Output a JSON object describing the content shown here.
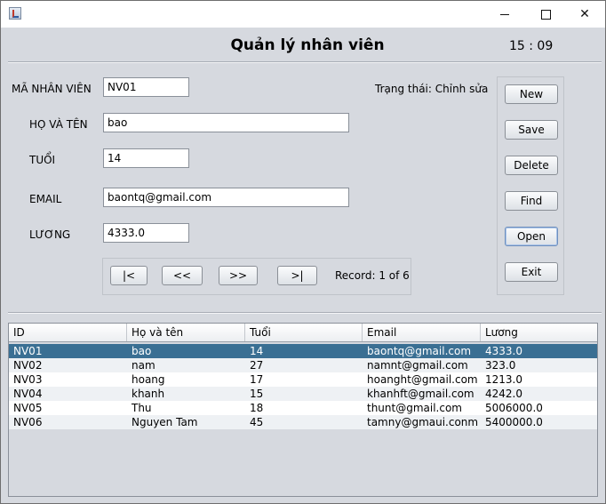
{
  "window": {
    "title_bar": {
      "minimize": "–",
      "maximize": "□",
      "close": "✕"
    }
  },
  "header": {
    "title": "Quản lý nhân viên",
    "clock": "15 : 09"
  },
  "form": {
    "id": {
      "label": "MÃ NHÂN VIÊN",
      "value": "NV01"
    },
    "name": {
      "label": "HỌ VÀ TÊN",
      "value": "bao"
    },
    "age": {
      "label": "TUỔI",
      "value": "14"
    },
    "email": {
      "label": "EMAIL",
      "value": "baontq@gmail.com"
    },
    "salary": {
      "label": "LƯƠNG",
      "value": "4333.0"
    },
    "status": "Trạng thái: Chỉnh sửa"
  },
  "actions": {
    "new": "New",
    "save": "Save",
    "delete": "Delete",
    "find": "Find",
    "open": "Open",
    "exit": "Exit"
  },
  "nav": {
    "first": "|<",
    "prev": "<<",
    "next": ">>",
    "last": ">|",
    "record": "Record: 1 of 6"
  },
  "table": {
    "columns": [
      "ID",
      "Họ và tên",
      "Tuổi",
      "Email",
      "Lương"
    ],
    "rows": [
      [
        "NV01",
        "bao",
        "14",
        "baontq@gmail.com",
        "4333.0"
      ],
      [
        "NV02",
        "nam",
        "27",
        "namnt@gmail.com",
        "323.0"
      ],
      [
        "NV03",
        "hoang",
        "17",
        "hoanght@gmail.com",
        "1213.0"
      ],
      [
        "NV04",
        "khanh",
        "15",
        "khanhft@gmail.com",
        "4242.0"
      ],
      [
        "NV05",
        "Thu",
        "18",
        "thunt@gmail.com",
        "5006000.0"
      ],
      [
        "NV06",
        "Nguyen Tam",
        "45",
        "tamny@gmaui.conm",
        "5400000.0"
      ]
    ],
    "selected_row": 0
  },
  "colors": {
    "selection": "#3a6f93",
    "window_bg": "#d6d9df"
  }
}
